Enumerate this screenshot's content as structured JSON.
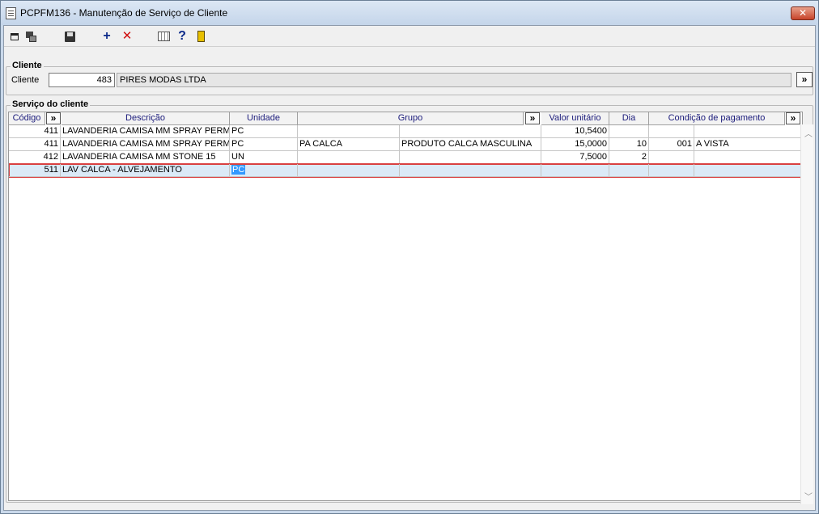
{
  "window": {
    "title": "PCPFM136 - Manutenção de Serviço de Cliente",
    "close_label": "✕"
  },
  "toolbar": {
    "buttons": [
      "export-icon",
      "copy-icon",
      "save-icon",
      "add-icon",
      "delete-icon",
      "calculator-icon",
      "help-icon",
      "exit-icon"
    ],
    "add_label": "+",
    "delete_label": "✕",
    "help_label": "?"
  },
  "cliente": {
    "group_label": "Cliente",
    "label": "Cliente",
    "code": "483",
    "name": "PIRES MODAS LTDA",
    "more_label": "»"
  },
  "servico": {
    "group_label": "Serviço do cliente",
    "expand_label": "»",
    "columns": [
      "Código",
      "Descrição",
      "Unidade",
      "Grupo",
      "Valor unitário",
      "Dia",
      "Condição de pagamento"
    ],
    "rows": [
      {
        "codigo": "411",
        "descricao": "LAVANDERIA CAMISA MM SPRAY PERMAN",
        "unidade": "PC",
        "grupo_cod": "",
        "grupo_desc": "",
        "valor": "10,5400",
        "dia": "",
        "cond_cod": "",
        "cond_desc": ""
      },
      {
        "codigo": "411",
        "descricao": "LAVANDERIA CAMISA MM SPRAY PERMAN",
        "unidade": "PC",
        "grupo_cod": "PA CALCA",
        "grupo_desc": "PRODUTO CALCA MASCULINA",
        "valor": "15,0000",
        "dia": "10",
        "cond_cod": "001",
        "cond_desc": "A VISTA"
      },
      {
        "codigo": "412",
        "descricao": "LAVANDERIA CAMISA MM STONE 15",
        "unidade": "UN",
        "grupo_cod": "",
        "grupo_desc": "",
        "valor": "7,5000",
        "dia": "2",
        "cond_cod": "",
        "cond_desc": ""
      },
      {
        "codigo": "511",
        "descricao": "LAV CALCA - ALVEJAMENTO",
        "unidade": "PC",
        "grupo_cod": "",
        "grupo_desc": "",
        "valor": "",
        "dia": "",
        "cond_cod": "",
        "cond_desc": ""
      }
    ],
    "selected_row": 4
  },
  "colors": {
    "window_frame": "#c9d8ea",
    "selection": "#3399ff",
    "highlight_border": "#d94040",
    "header_text": "#1a1a7a"
  }
}
